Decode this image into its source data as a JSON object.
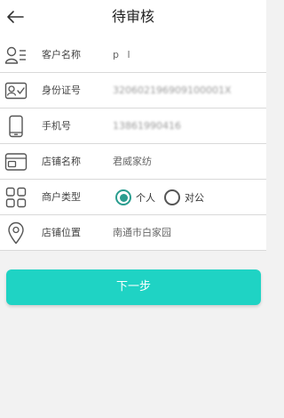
{
  "header": {
    "title": "待审核"
  },
  "form": {
    "merchant_name": {
      "label": "客户名称",
      "value": "p l"
    },
    "id_number": {
      "label": "身份证号",
      "value": "320602196909100001X"
    },
    "phone": {
      "label": "手机号",
      "value": "13861990416"
    },
    "store_name": {
      "label": "店铺名称",
      "value": "君威家纺"
    },
    "merchant_type": {
      "label": "商户类型",
      "options": [
        {
          "label": "个人",
          "selected": true
        },
        {
          "label": "对公",
          "selected": false
        }
      ]
    },
    "store_location": {
      "label": "店铺位置",
      "value": "南通市白家园"
    }
  },
  "next_button": {
    "label": "下一步"
  },
  "colors": {
    "accent": "#1fd3c4",
    "radio_selected": "#2a9d8f"
  }
}
